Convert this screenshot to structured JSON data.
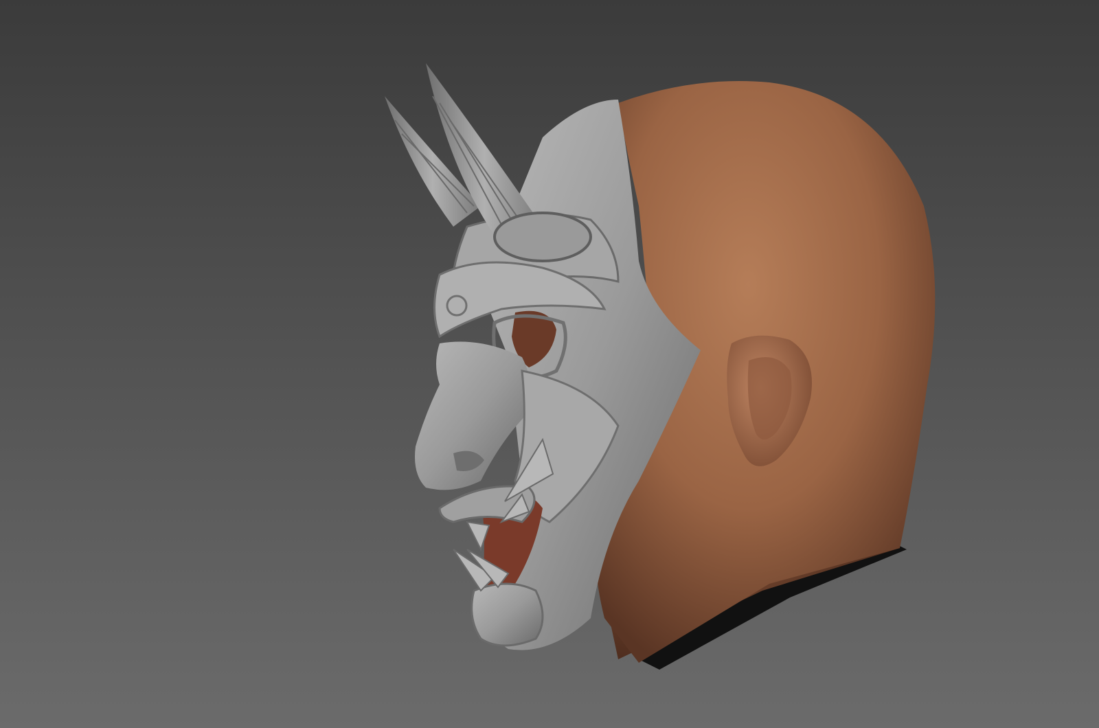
{
  "viewport": {
    "background_top": "#3a3a3a",
    "background_bottom": "#6a6a6a"
  },
  "model": {
    "subject": "head-with-oni-mask",
    "mask_color": "#9c9c9c",
    "mask_highlight": "#c2c2c2",
    "mask_shadow": "#5e5e5e",
    "skin_color": "#a8714e",
    "skin_shadow": "#5a3524",
    "mouth_color": "#7a3a2a",
    "neck_cloth_color": "#111111"
  }
}
